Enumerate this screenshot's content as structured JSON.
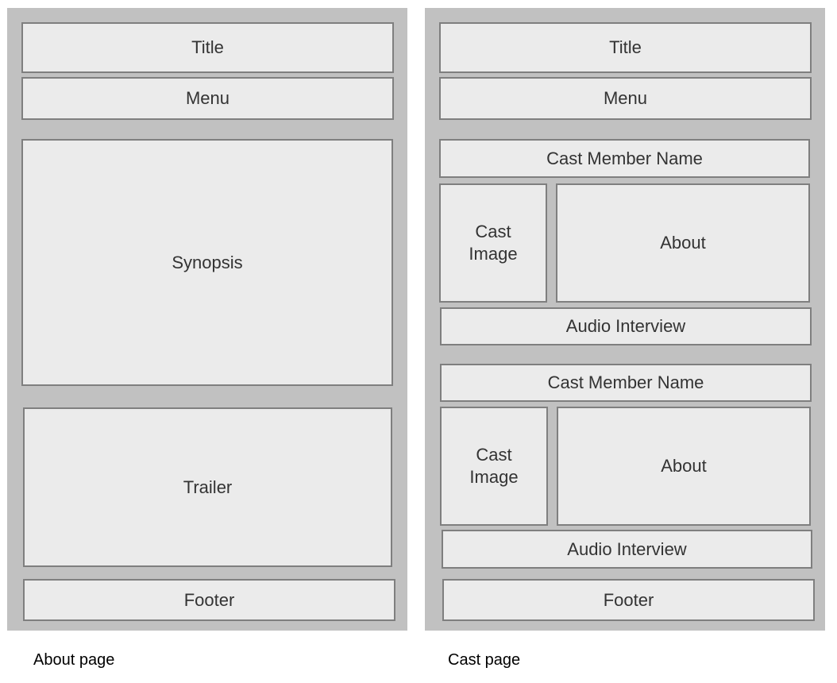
{
  "about_page": {
    "caption": "About page",
    "title": "Title",
    "menu": "Menu",
    "synopsis": "Synopsis",
    "trailer": "Trailer",
    "footer": "Footer"
  },
  "cast_page": {
    "caption": "Cast page",
    "title": "Title",
    "menu": "Menu",
    "cast_blocks": [
      {
        "name": "Cast Member Name",
        "image": "Cast\nImage",
        "about": "About",
        "audio": "Audio Interview"
      },
      {
        "name": "Cast Member Name",
        "image": "Cast\nImage",
        "about": "About",
        "audio": "Audio Interview"
      }
    ],
    "footer": "Footer"
  },
  "colors": {
    "panel_bg": "#c1c1c1",
    "box_bg": "#ebebeb",
    "box_border": "#7f7f7f",
    "box_text": "#333333"
  }
}
